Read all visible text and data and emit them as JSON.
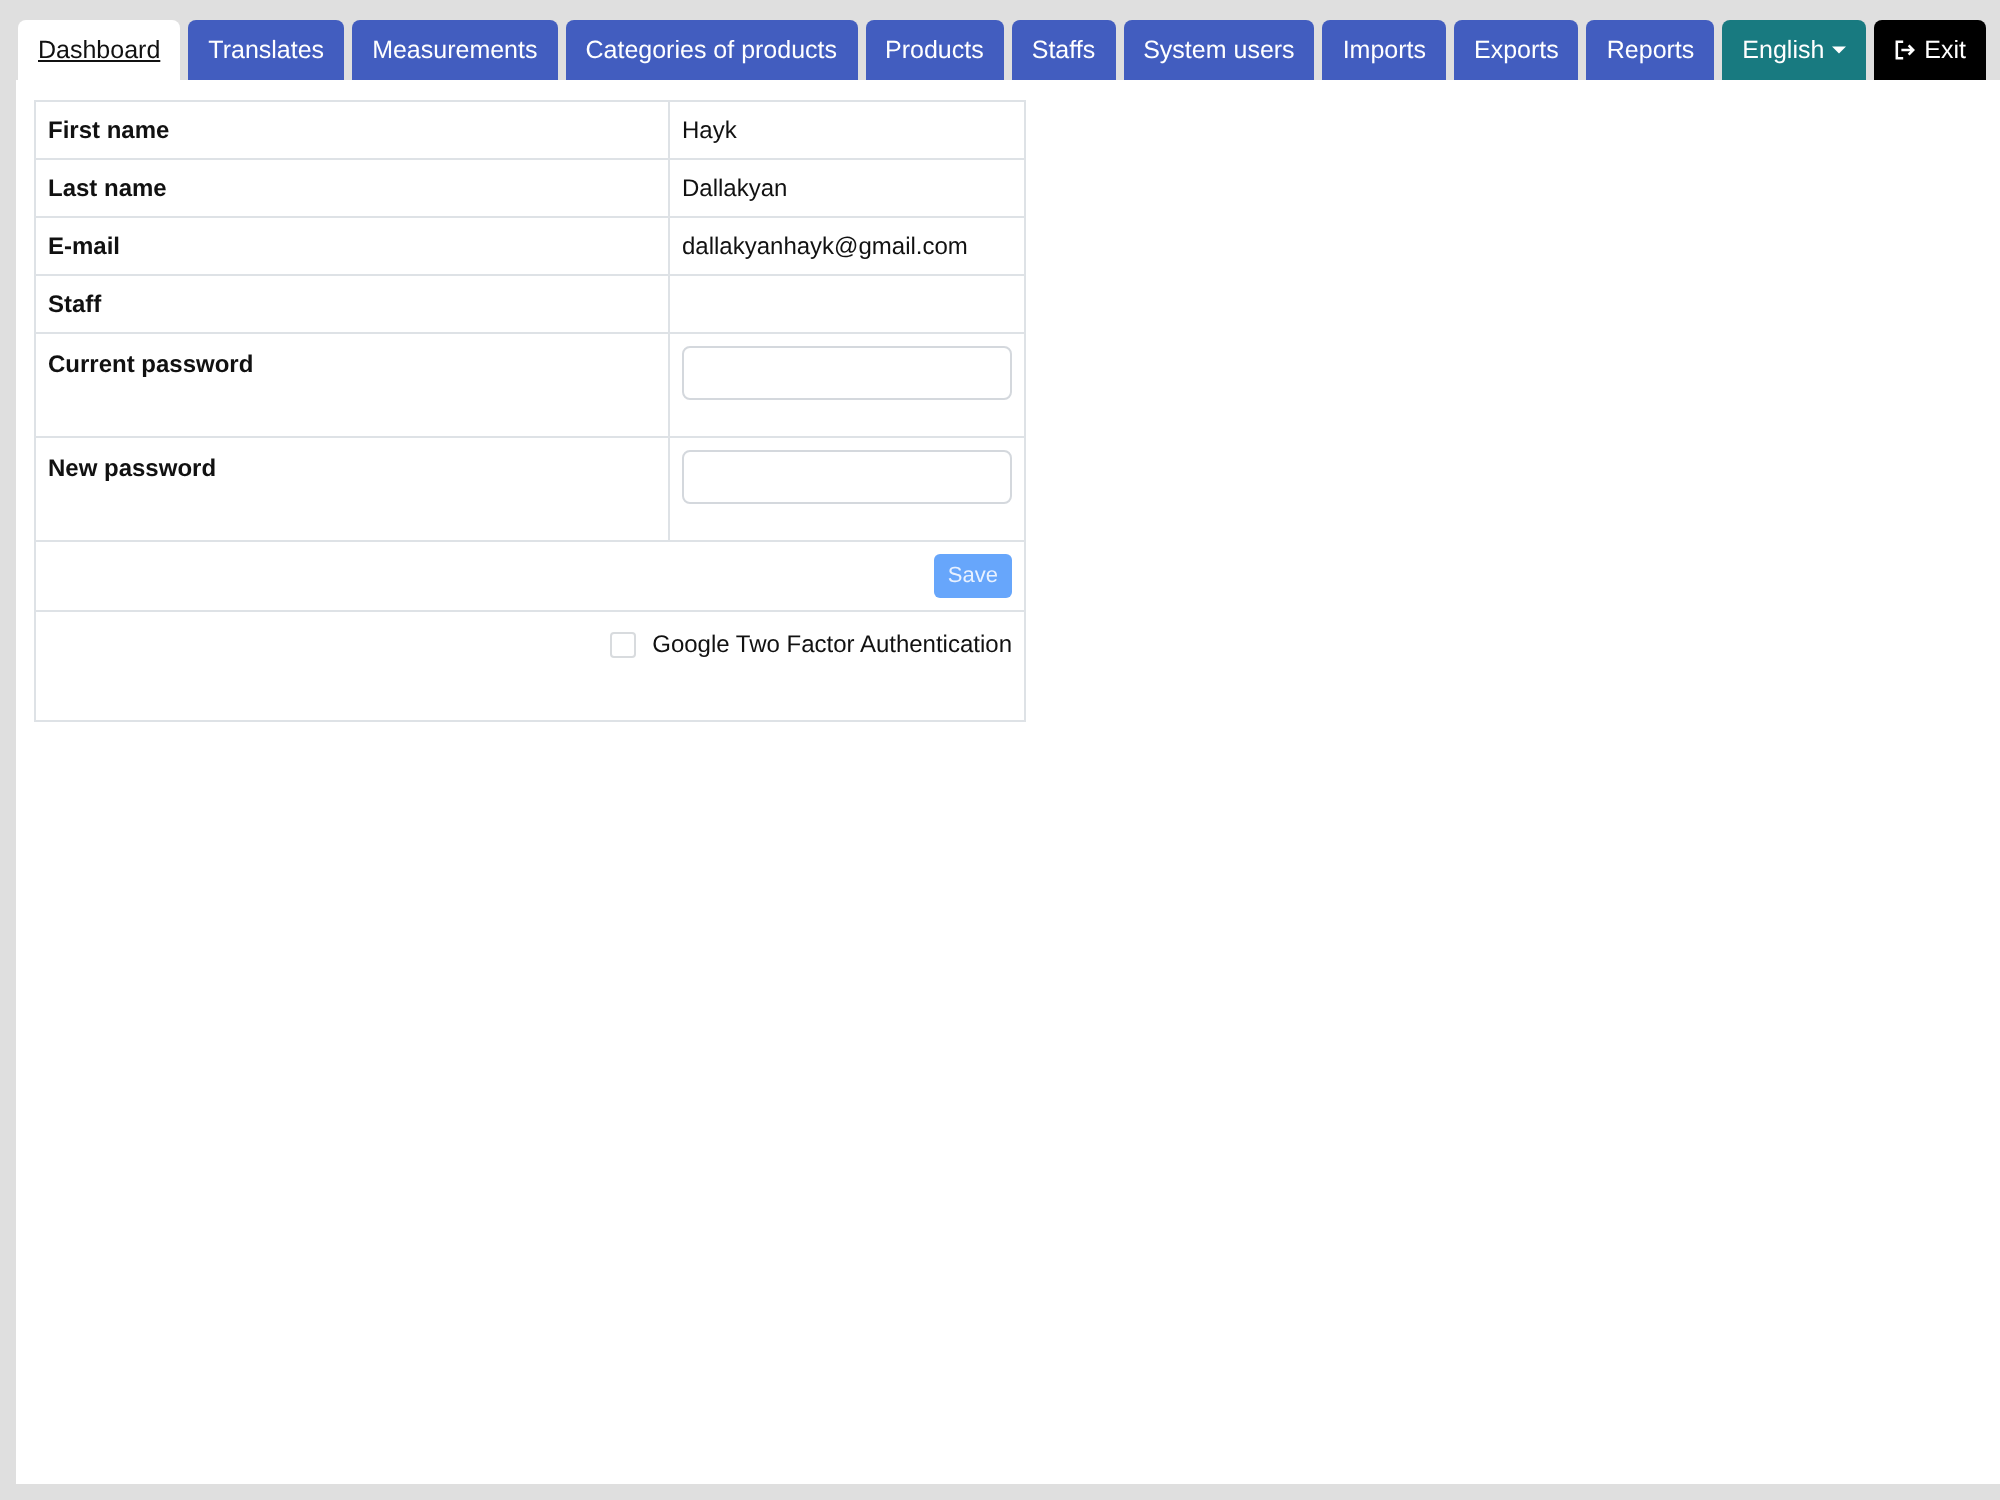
{
  "tabs": [
    {
      "label": "Dashboard",
      "kind": "nav",
      "selected": true
    },
    {
      "label": "Translates",
      "kind": "nav",
      "selected": false
    },
    {
      "label": "Measurements",
      "kind": "nav",
      "selected": false
    },
    {
      "label": "Categories of products",
      "kind": "nav",
      "selected": false
    },
    {
      "label": "Products",
      "kind": "nav",
      "selected": false
    },
    {
      "label": "Staffs",
      "kind": "nav",
      "selected": false
    },
    {
      "label": "System users",
      "kind": "nav",
      "selected": false
    },
    {
      "label": "Imports",
      "kind": "nav",
      "selected": false
    },
    {
      "label": "Exports",
      "kind": "nav",
      "selected": false
    },
    {
      "label": "Reports",
      "kind": "nav",
      "selected": false
    },
    {
      "label": "English",
      "kind": "dropdown",
      "selected": false
    },
    {
      "label": "Exit",
      "kind": "exit",
      "selected": false
    }
  ],
  "profile": {
    "rows": [
      {
        "label": "First name",
        "kind": "text",
        "value": "Hayk"
      },
      {
        "label": "Last name",
        "kind": "text",
        "value": "Dallakyan"
      },
      {
        "label": "E-mail",
        "kind": "text",
        "value": "dallakyanhayk@gmail.com"
      },
      {
        "label": "Staff",
        "kind": "text"
      },
      {
        "label": "Current password",
        "kind": "password"
      },
      {
        "label": "New password",
        "kind": "password"
      }
    ],
    "save_button": {
      "label": "Save",
      "disabled": true
    },
    "two_factor": {
      "label": "Google Two Factor Authentication",
      "checked": false
    }
  }
}
